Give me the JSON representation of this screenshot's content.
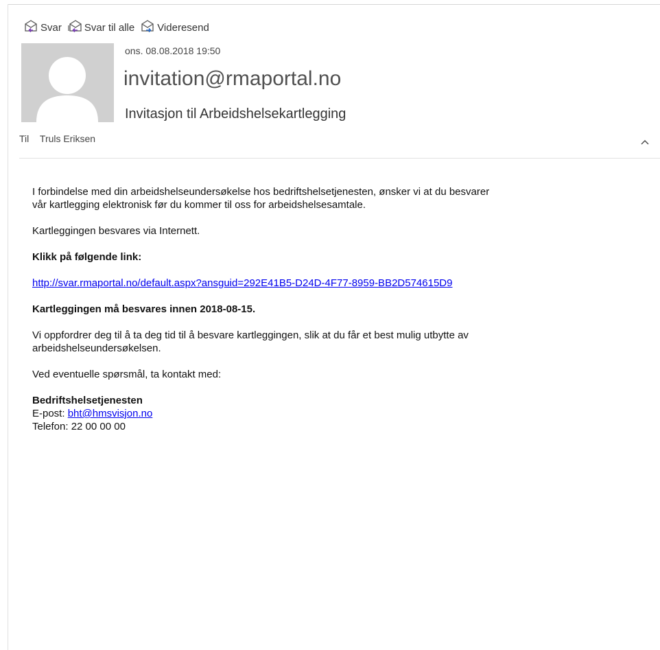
{
  "toolbar": {
    "reply_label": "Svar",
    "reply_all_label": "Svar til alle",
    "forward_label": "Videresend"
  },
  "header": {
    "date": "ons. 08.08.2018 19:50",
    "sender": "invitation@rmaportal.no",
    "subject": "Invitasjon til Arbeidshelsekartlegging",
    "to_label": "Til",
    "to_name": "Truls Eriksen"
  },
  "message": {
    "p1": "I forbindelse med din arbeidshelseundersøkelse hos bedriftshelsetjenesten, ønsker vi at du besvarer",
    "p1b": "vår kartlegging elektronisk før du kommer til oss for arbeidshelsesamtale.",
    "p2": "Kartleggingen besvares via Internett.",
    "p3": "Klikk på følgende link:",
    "link": "http://svar.rmaportal.no/default.aspx?ansguid=292E41B5-D24D-4F77-8959-BB2D574615D9",
    "p4": "Kartleggingen må besvares innen 2018-08-15.",
    "p5": "Vi oppfordrer deg til å ta deg tid til å besvare kartleggingen, slik at du får et best mulig utbytte av",
    "p5b": "arbeidshelseundersøkelsen.",
    "p6": "Ved eventuelle spørsmål, ta kontakt med:",
    "org": "Bedriftshelsetjenesten",
    "email_label": "E-post: ",
    "email": "bht@hmsvisjon.no",
    "phone": "Telefon: 22 00 00 00"
  },
  "colors": {
    "link": "#0000ee",
    "accent_purple": "#7a3db8",
    "accent_blue": "#2b6cc4"
  }
}
